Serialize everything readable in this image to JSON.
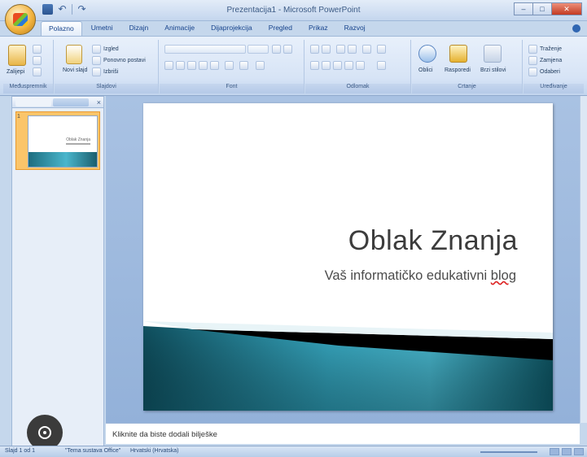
{
  "window": {
    "title": "Prezentacija1 - Microsoft PowerPoint",
    "minimize_label": "–",
    "maximize_label": "□",
    "close_label": "✕"
  },
  "quick_access": {
    "undo_label": "↶",
    "redo_label": "↷"
  },
  "ribbon_tabs": [
    "Polazno",
    "Umetni",
    "Dizajn",
    "Animacije",
    "Dijaprojekcija",
    "Pregled",
    "Prikaz",
    "Razvoj"
  ],
  "ribbon_groups": {
    "clipboard": {
      "label": "Međuspremnik",
      "paste": "Zalijepi",
      "cut": "Izreži",
      "copy": "Kopiraj",
      "format_painter": "Prenositelj oblikovanja"
    },
    "slides": {
      "label": "Slajdovi",
      "new_slide": "Novi slajd",
      "layout": "Izgled",
      "reset": "Ponovno postavi",
      "delete": "Izbriši"
    },
    "font": {
      "label": "Font"
    },
    "paragraph": {
      "label": "Odlomak"
    },
    "drawing": {
      "label": "Crtanje",
      "shapes": "Oblici",
      "arrange": "Rasporedi",
      "quick_styles": "Brzi stilovi"
    },
    "editing": {
      "label": "Uređivanje",
      "find": "Traženje",
      "replace": "Zamjena",
      "select": "Odaberi"
    }
  },
  "slide": {
    "title": "Oblak Znanja",
    "subtitle_main": "Vaš informatičko edukativni ",
    "subtitle_flagged": "blog"
  },
  "thumbnail": {
    "number": "1",
    "title": "Oblak Znanja"
  },
  "notes": {
    "placeholder": "Kliknite da biste dodali bilješke"
  },
  "statusbar": {
    "slide_info": "Slajd 1 od 1",
    "theme": "\"Tema sustava Office\"",
    "language": "Hrvatski (Hrvatska)"
  },
  "colors": {
    "ribbon": "#d7e4f6",
    "workspace": "#a9c2e3",
    "accent_teal": "#2a8ea3",
    "selection": "#fbc56a"
  }
}
